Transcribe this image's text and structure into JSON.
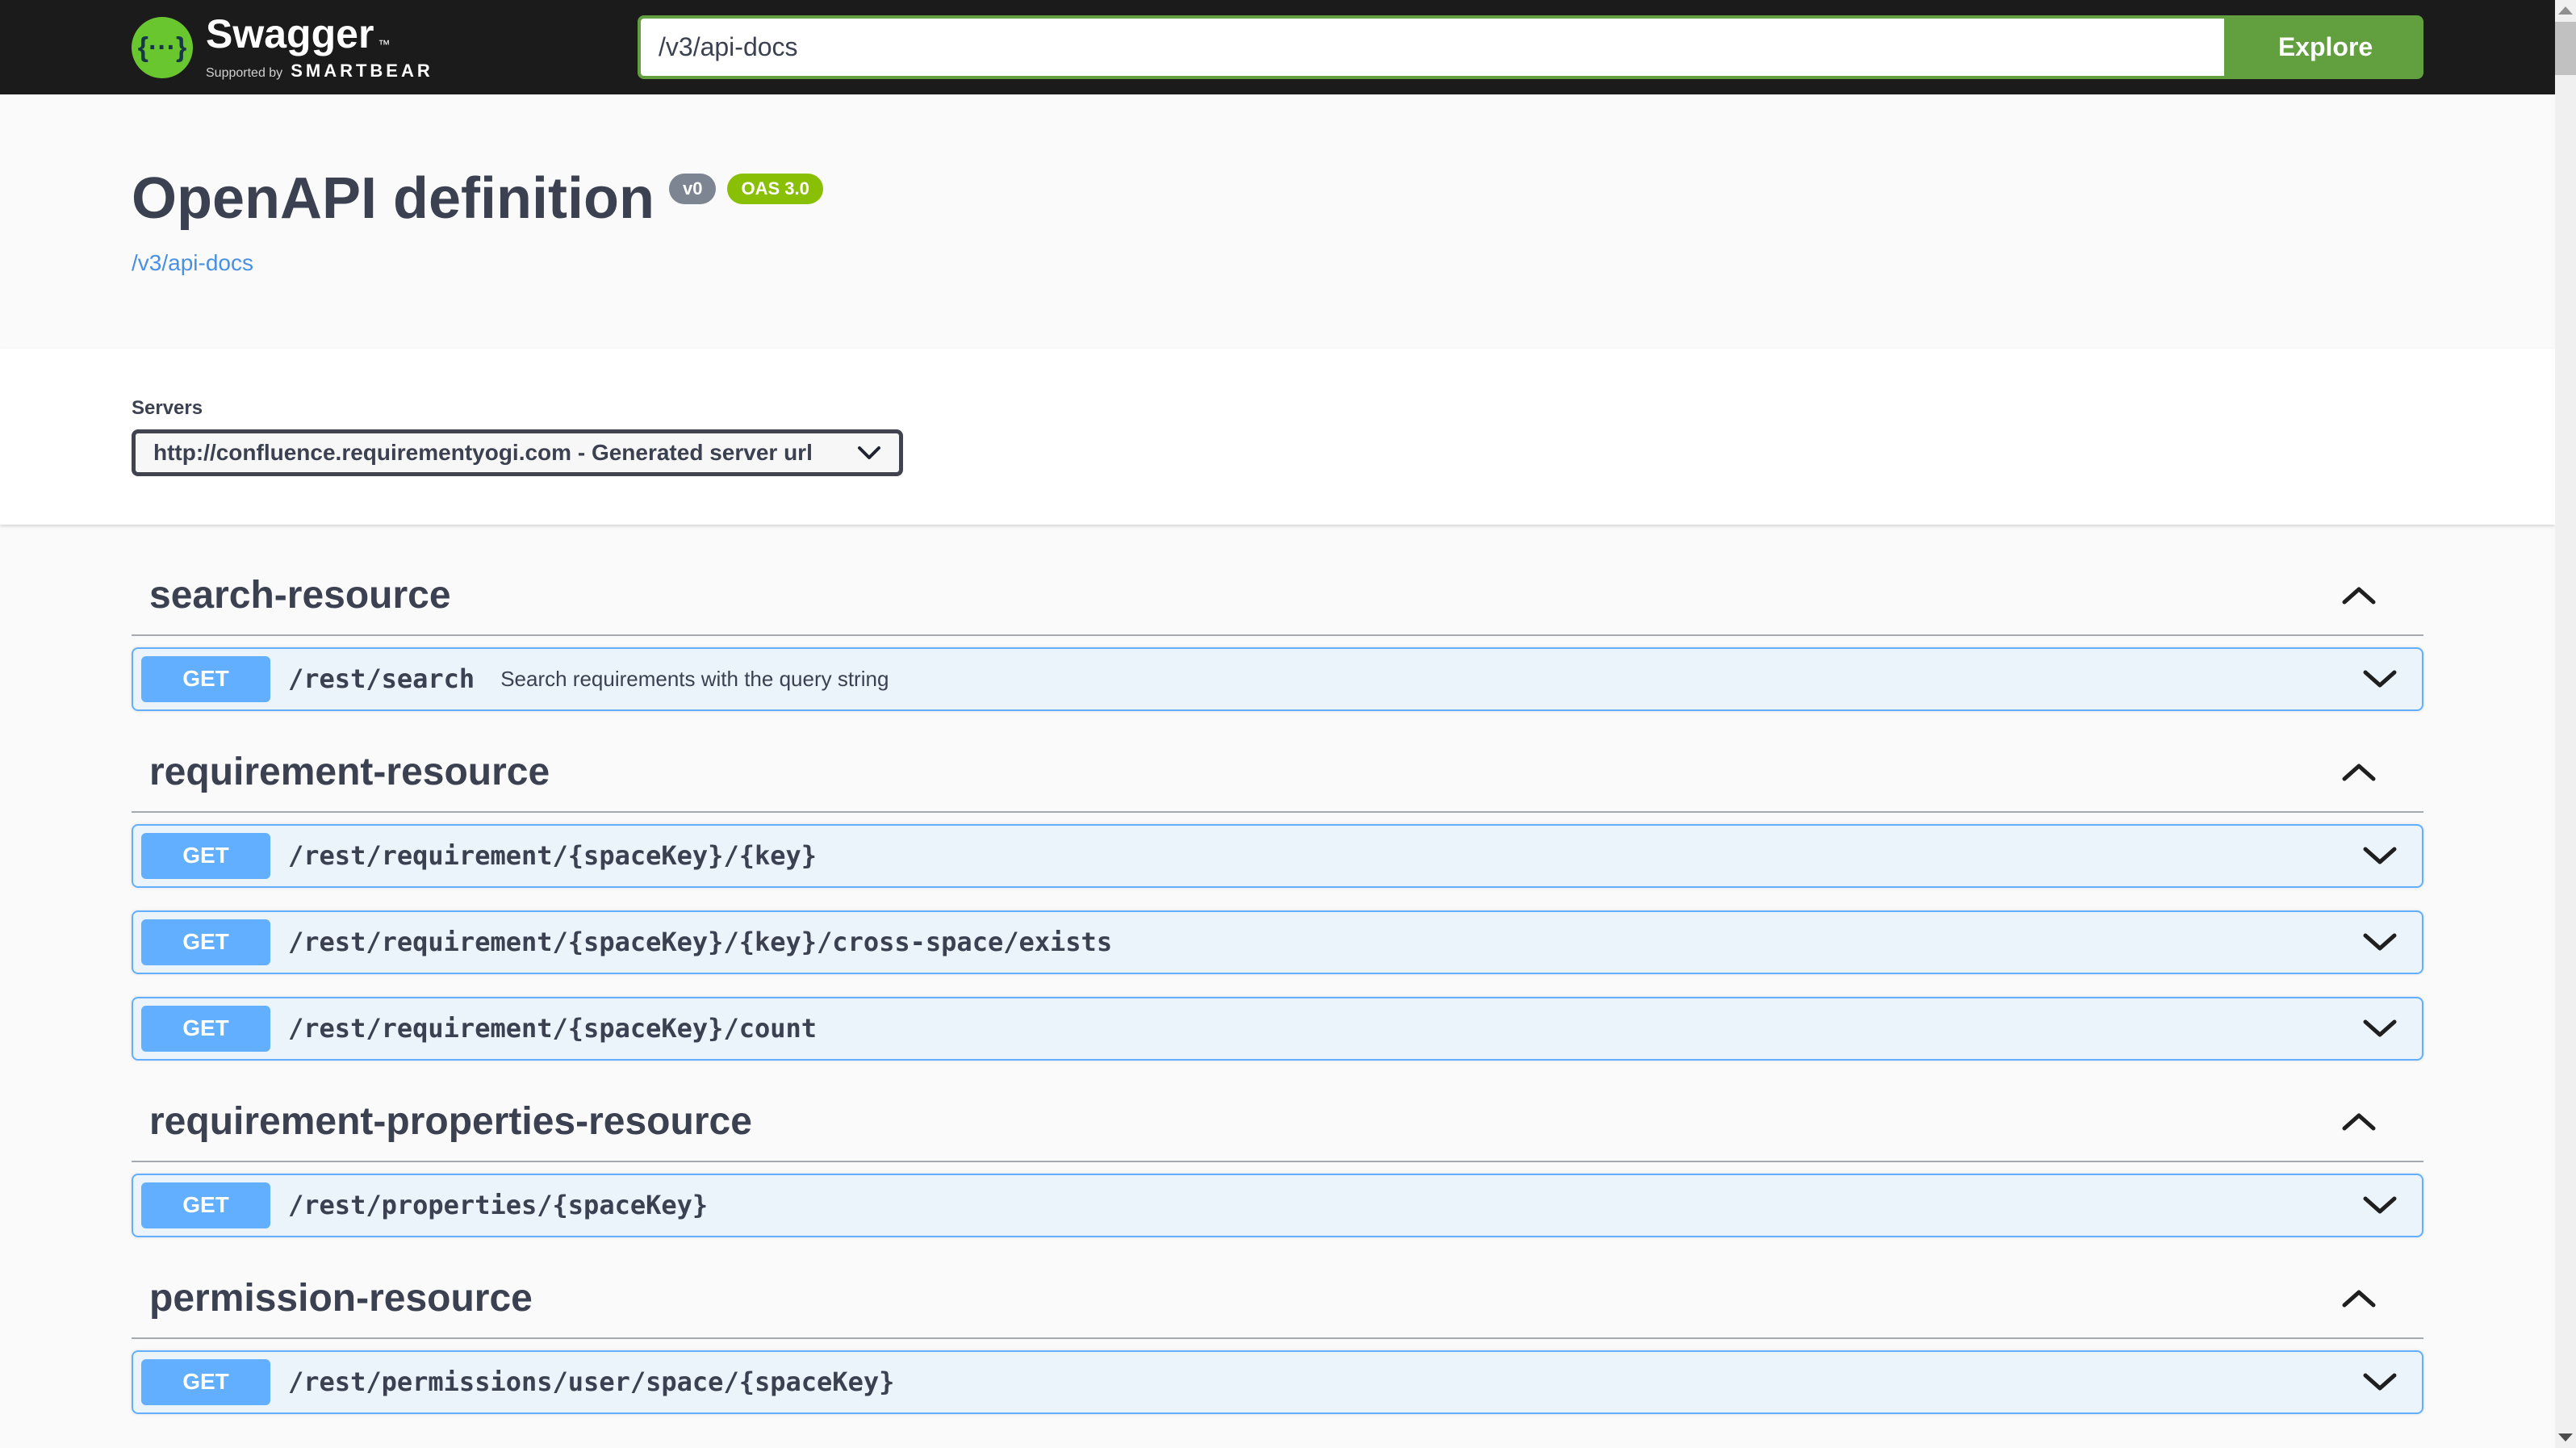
{
  "topbar": {
    "brand": "Swagger",
    "trademark": "™",
    "supported_by": "Supported by",
    "smartbear": "SMARTBEAR",
    "logo_glyph": "{···}",
    "url_input_value": "/v3/api-docs",
    "explore_button": "Explore"
  },
  "info": {
    "title": "OpenAPI definition",
    "version_badge": "v0",
    "oas_badge": "OAS 3.0",
    "spec_link": "/v3/api-docs"
  },
  "servers": {
    "label": "Servers",
    "selected_option": "http://confluence.requirementyogi.com - Generated server url"
  },
  "colors": {
    "topbar_bg": "#1b1b1b",
    "accent_green": "#62a03f",
    "oas_badge_green": "#89bf04",
    "version_badge_gray": "#7d8492",
    "get_method_blue": "#61affe",
    "operation_row_bg": "#ebf3fb",
    "heading_text": "#3b4151",
    "link_blue": "#4990e2",
    "page_bg": "#fafafa"
  },
  "sections": [
    {
      "title": "search-resource",
      "expanded": true,
      "rows": [
        {
          "method": "GET",
          "path": "/rest/search",
          "description": "Search requirements with the query string"
        }
      ]
    },
    {
      "title": "requirement-resource",
      "expanded": true,
      "rows": [
        {
          "method": "GET",
          "path": "/rest/requirement/{spaceKey}/{key}",
          "description": ""
        },
        {
          "method": "GET",
          "path": "/rest/requirement/{spaceKey}/{key}/cross-space/exists",
          "description": ""
        },
        {
          "method": "GET",
          "path": "/rest/requirement/{spaceKey}/count",
          "description": ""
        }
      ]
    },
    {
      "title": "requirement-properties-resource",
      "expanded": true,
      "rows": [
        {
          "method": "GET",
          "path": "/rest/properties/{spaceKey}",
          "description": ""
        }
      ]
    },
    {
      "title": "permission-resource",
      "expanded": true,
      "rows": [
        {
          "method": "GET",
          "path": "/rest/permissions/user/space/{spaceKey}",
          "description": ""
        }
      ]
    }
  ]
}
